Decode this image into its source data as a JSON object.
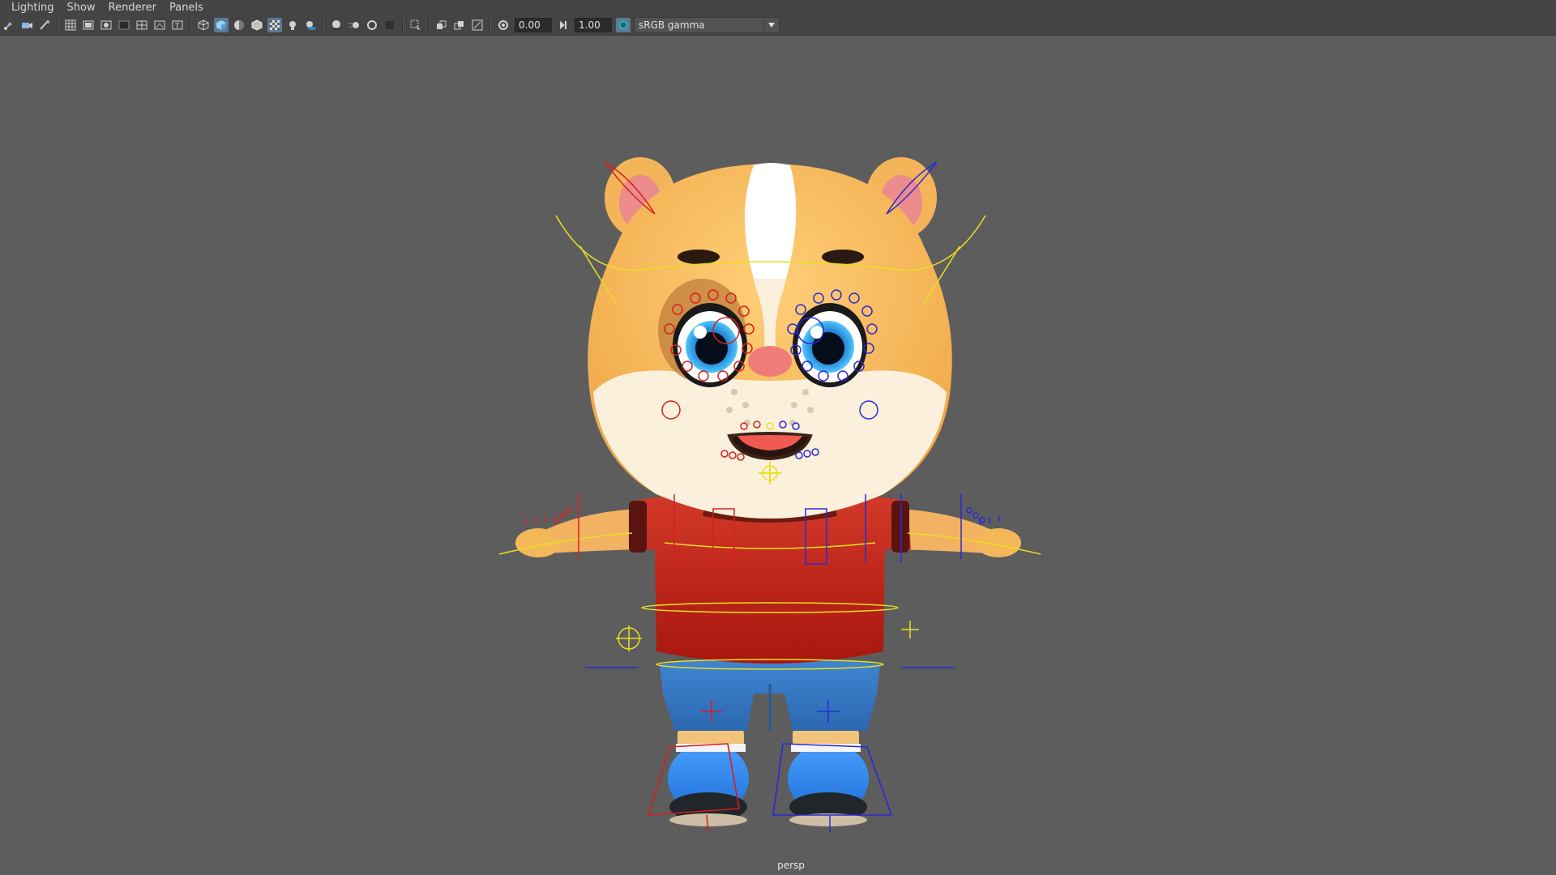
{
  "menu": {
    "items": [
      "Lighting",
      "Show",
      "Renderer",
      "Panels"
    ]
  },
  "toolbar": {
    "exposure_value": "0.00",
    "gamma_value": "1.00",
    "color_space": "sRGB gamma",
    "icons": [
      "select-camera-icon",
      "camera-attributes-icon",
      "bookmarks-icon",
      "grid-icon",
      "film-gate-icon",
      "resolution-gate-icon",
      "gate-mask-icon",
      "field-chart-icon",
      "safe-action-icon",
      "safe-title-icon",
      "wireframe-icon",
      "smooth-shade-icon",
      "wireframe-on-shaded-icon",
      "textured-icon",
      "xray-icon",
      "lights-icon",
      "shadows-icon",
      "ambient-occlusion-icon",
      "motion-blur-icon",
      "anti-aliasing-icon",
      "depth-of-field-icon",
      "isolate-select-icon",
      "xray-joints-icon",
      "xray-active-icon",
      "hud-icon",
      "exposure-icon",
      "gamma-icon",
      "color-management-icon",
      "dropdown-arrow-icon"
    ]
  },
  "viewport": {
    "camera_name": "persp",
    "background_color": "#5d5d5d"
  },
  "colors": {
    "ui_bar": "#444444",
    "active_icon": "#5a7a96",
    "rig_left": "#d42020",
    "rig_right": "#2a2ad8",
    "rig_center": "#e8e020",
    "fur": "#f4b85a",
    "shirt": "#c2281e",
    "pants": "#3a7cc8",
    "shoes": "#3388e8"
  }
}
